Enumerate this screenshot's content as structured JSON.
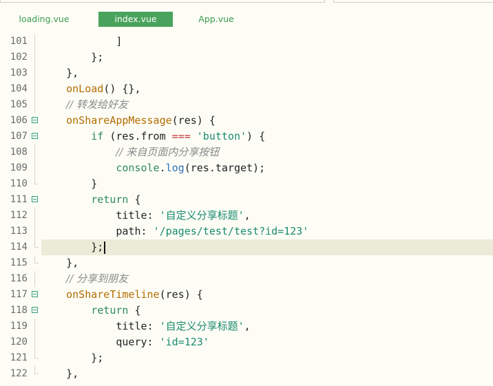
{
  "tabs": [
    {
      "label": "loading.vue",
      "active": false
    },
    {
      "label": "index.vue",
      "active": true
    },
    {
      "label": "App.vue",
      "active": false
    }
  ],
  "colors": {
    "background": "#fdfdf6",
    "active_tab": "#4aa35c",
    "tab_text": "#3a9a4e",
    "current_line": "#ebebd8",
    "keyword": "#2e8b57",
    "function": "#b36b00",
    "string": "#1a8a70",
    "comment": "#8a8a8a"
  },
  "editor": {
    "current_line": 114,
    "lines": [
      {
        "num": "101",
        "fold": "none",
        "tokens": [
          {
            "t": "            ]",
            "c": "pl"
          }
        ]
      },
      {
        "num": "102",
        "fold": "none",
        "tokens": [
          {
            "t": "        };",
            "c": "pl"
          }
        ]
      },
      {
        "num": "103",
        "fold": "none",
        "tokens": [
          {
            "t": "    },",
            "c": "pl"
          }
        ]
      },
      {
        "num": "104",
        "fold": "none",
        "tokens": [
          {
            "t": "    ",
            "c": "pl"
          },
          {
            "t": "onLoad",
            "c": "fn"
          },
          {
            "t": "() {},",
            "c": "pl"
          }
        ]
      },
      {
        "num": "105",
        "fold": "none",
        "tokens": [
          {
            "t": "    ",
            "c": "pl"
          },
          {
            "t": "// 转发给好友",
            "c": "cm"
          }
        ]
      },
      {
        "num": "106",
        "fold": "open",
        "tokens": [
          {
            "t": "    ",
            "c": "pl"
          },
          {
            "t": "onShareAppMessage",
            "c": "fn"
          },
          {
            "t": "(res) {",
            "c": "pl"
          }
        ]
      },
      {
        "num": "107",
        "fold": "open",
        "tokens": [
          {
            "t": "        ",
            "c": "pl"
          },
          {
            "t": "if",
            "c": "kw"
          },
          {
            "t": " (res.from ",
            "c": "pl"
          },
          {
            "t": "===",
            "c": "op"
          },
          {
            "t": " ",
            "c": "pl"
          },
          {
            "t": "'button'",
            "c": "str"
          },
          {
            "t": ") {",
            "c": "pl"
          }
        ]
      },
      {
        "num": "108",
        "fold": "none",
        "tokens": [
          {
            "t": "            ",
            "c": "pl"
          },
          {
            "t": "// 来自页面内分享按钮",
            "c": "cm"
          }
        ]
      },
      {
        "num": "109",
        "fold": "none",
        "tokens": [
          {
            "t": "            ",
            "c": "pl"
          },
          {
            "t": "console",
            "c": "var"
          },
          {
            "t": ".",
            "c": "pl"
          },
          {
            "t": "log",
            "c": "m"
          },
          {
            "t": "(res.target);",
            "c": "pl"
          }
        ]
      },
      {
        "num": "110",
        "fold": "end",
        "tokens": [
          {
            "t": "        }",
            "c": "pl"
          }
        ]
      },
      {
        "num": "111",
        "fold": "open",
        "tokens": [
          {
            "t": "        ",
            "c": "pl"
          },
          {
            "t": "return",
            "c": "kw"
          },
          {
            "t": " {",
            "c": "pl"
          }
        ]
      },
      {
        "num": "112",
        "fold": "none",
        "tokens": [
          {
            "t": "            title: ",
            "c": "pl"
          },
          {
            "t": "'自定义分享标题'",
            "c": "str"
          },
          {
            "t": ",",
            "c": "pl"
          }
        ]
      },
      {
        "num": "113",
        "fold": "none",
        "tokens": [
          {
            "t": "            path: ",
            "c": "pl"
          },
          {
            "t": "'/pages/test/test?id=123'",
            "c": "str"
          }
        ]
      },
      {
        "num": "114",
        "fold": "end",
        "tokens": [
          {
            "t": "        };",
            "c": "pl"
          }
        ]
      },
      {
        "num": "115",
        "fold": "end",
        "tokens": [
          {
            "t": "    },",
            "c": "pl"
          }
        ]
      },
      {
        "num": "116",
        "fold": "none",
        "tokens": [
          {
            "t": "    ",
            "c": "pl"
          },
          {
            "t": "// 分享到朋友",
            "c": "cm"
          }
        ]
      },
      {
        "num": "117",
        "fold": "open",
        "tokens": [
          {
            "t": "    ",
            "c": "pl"
          },
          {
            "t": "onShareTimeline",
            "c": "fn"
          },
          {
            "t": "(res) {",
            "c": "pl"
          }
        ]
      },
      {
        "num": "118",
        "fold": "open",
        "tokens": [
          {
            "t": "        ",
            "c": "pl"
          },
          {
            "t": "return",
            "c": "kw"
          },
          {
            "t": " {",
            "c": "pl"
          }
        ]
      },
      {
        "num": "119",
        "fold": "none",
        "tokens": [
          {
            "t": "            title: ",
            "c": "pl"
          },
          {
            "t": "'自定义分享标题'",
            "c": "str"
          },
          {
            "t": ",",
            "c": "pl"
          }
        ]
      },
      {
        "num": "120",
        "fold": "none",
        "tokens": [
          {
            "t": "            query: ",
            "c": "pl"
          },
          {
            "t": "'id=123'",
            "c": "str"
          }
        ]
      },
      {
        "num": "121",
        "fold": "end",
        "tokens": [
          {
            "t": "        };",
            "c": "pl"
          }
        ]
      },
      {
        "num": "122",
        "fold": "end",
        "tokens": [
          {
            "t": "    },",
            "c": "pl"
          }
        ]
      }
    ]
  }
}
